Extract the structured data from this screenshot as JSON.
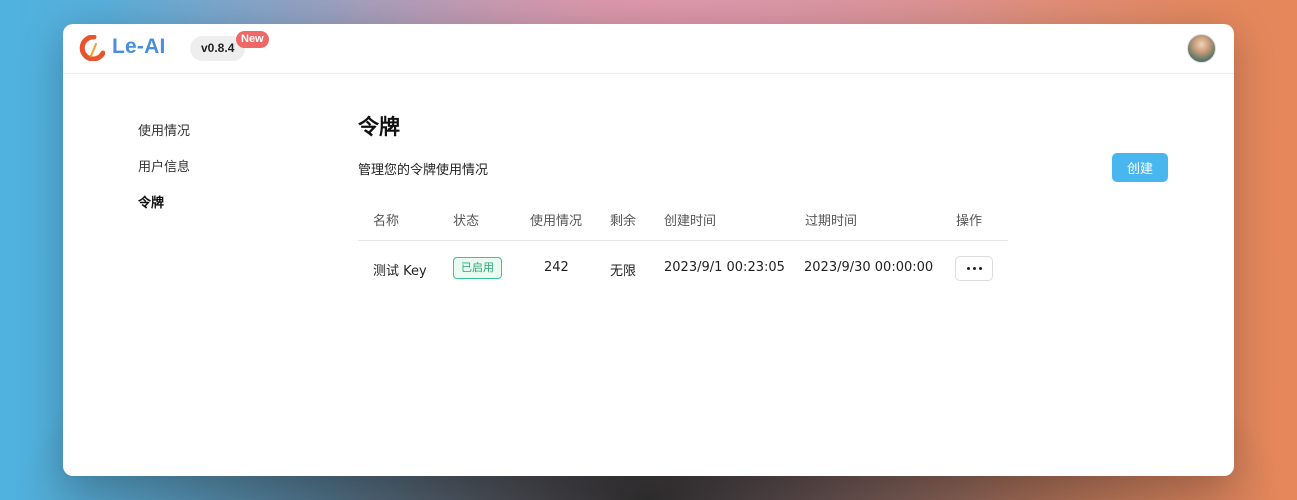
{
  "app": {
    "name": "Le-AI",
    "version": "v0.8.4",
    "new_badge": "New",
    "brand_color": "#4a8ee0",
    "logo_colors": [
      "#e8542b",
      "#f2a23c"
    ]
  },
  "sidebar": {
    "items": [
      {
        "label": "使用情况",
        "active": false
      },
      {
        "label": "用户信息",
        "active": false
      },
      {
        "label": "令牌",
        "active": true
      }
    ]
  },
  "main": {
    "title": "令牌",
    "description": "管理您的令牌使用情况",
    "create_label": "创建",
    "accent_color": "#48b6ef"
  },
  "table": {
    "columns": [
      "名称",
      "状态",
      "使用情况",
      "剩余",
      "创建时间",
      "过期时间",
      "操作"
    ],
    "rows": [
      {
        "name": "测试 Key",
        "status": "已启用",
        "usage": "242",
        "remaining": "无限",
        "created": "2023/9/1 00:23:05",
        "expires": "2023/9/30 00:00:00",
        "action_icon": "more-horizontal-icon"
      }
    ]
  },
  "user": {
    "avatar_icon": "user-avatar"
  }
}
